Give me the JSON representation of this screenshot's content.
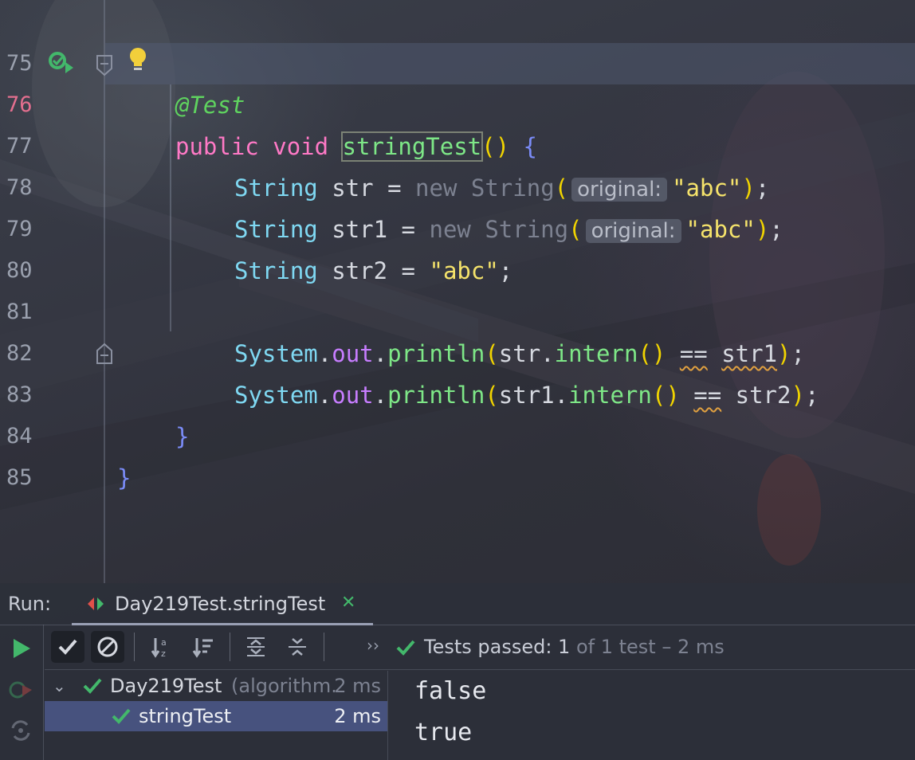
{
  "editor": {
    "lines": [
      {
        "num": "75"
      },
      {
        "num": "76"
      },
      {
        "num": "77"
      },
      {
        "num": "78"
      },
      {
        "num": "79"
      },
      {
        "num": "80"
      },
      {
        "num": "81"
      },
      {
        "num": "82"
      },
      {
        "num": "83"
      },
      {
        "num": "84"
      },
      {
        "num": "85"
      }
    ],
    "code": {
      "annotation": "@Test",
      "public_kw": "public",
      "void_kw": "void",
      "method_name": "stringTest",
      "method_parens": "()",
      "open_brace": "{",
      "str_type": "String",
      "var_str": "str",
      "var_str1": "str1",
      "var_str2": "str2",
      "assign": "=",
      "new_kw": "new",
      "ctor": "String",
      "param_hint": "original:",
      "abc_literal": "\"abc\"",
      "system": "System",
      "out": "out",
      "println": "println",
      "intern": "intern",
      "eq": "==",
      "close_brace": "}"
    }
  },
  "run": {
    "label": "Run:",
    "tab_label": "Day219Test.stringTest",
    "status_prefix": "Tests passed: 1",
    "status_suffix": " of 1 test – 2 ms",
    "tree": [
      {
        "name": "Day219Test",
        "detail": "(algorithm.",
        "time": "2 ms"
      },
      {
        "name": "stringTest",
        "time": "2 ms"
      }
    ],
    "output": [
      "false",
      "true"
    ]
  },
  "colors": {
    "pass": "#43b86b",
    "bulb": "#f2cf3b",
    "line_active": "#e46f8f"
  }
}
